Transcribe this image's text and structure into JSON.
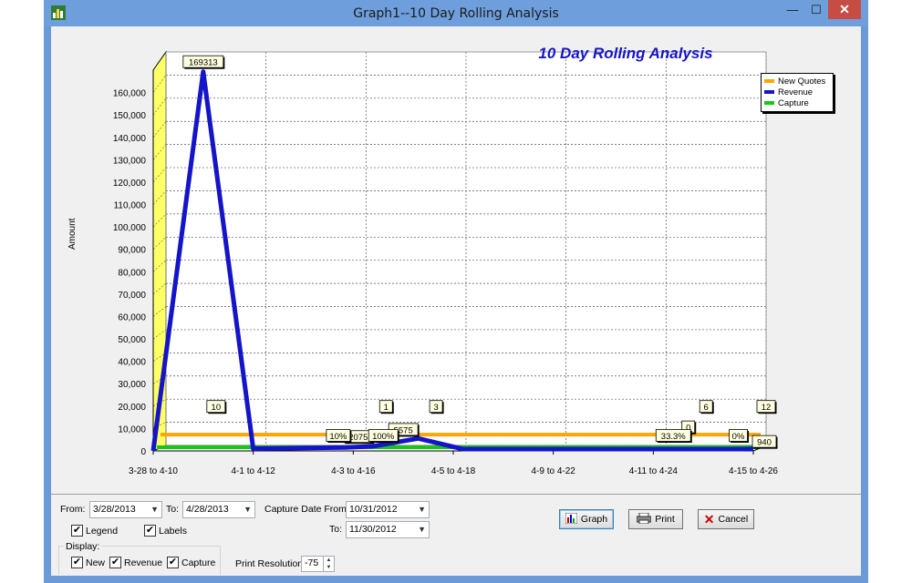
{
  "window": {
    "title": "Graph1--10 Day Rolling Analysis",
    "min_glyph": "—",
    "max_glyph": "☐",
    "close_glyph": "✕"
  },
  "colors": {
    "new_quotes": "#ffa500",
    "revenue": "#1414c8",
    "capture": "#14c814",
    "wall": "#ffff66",
    "title": "#1515c8"
  },
  "chart_data": {
    "type": "line",
    "title": "10 Day Rolling Analysis",
    "ylabel": "Amount",
    "xlabel": "",
    "ylim": [
      0,
      170000
    ],
    "yticks": [
      {
        "value": 0,
        "label": "0"
      },
      {
        "value": 10000,
        "label": "10,000"
      },
      {
        "value": 20000,
        "label": "20,000"
      },
      {
        "value": 30000,
        "label": "30,000"
      },
      {
        "value": 40000,
        "label": "40,000"
      },
      {
        "value": 50000,
        "label": "50,000"
      },
      {
        "value": 60000,
        "label": "60,000"
      },
      {
        "value": 70000,
        "label": "70,000"
      },
      {
        "value": 80000,
        "label": "80,000"
      },
      {
        "value": 90000,
        "label": "90,000"
      },
      {
        "value": 100000,
        "label": "100,000"
      },
      {
        "value": 110000,
        "label": "110,000"
      },
      {
        "value": 120000,
        "label": "120,000"
      },
      {
        "value": 130000,
        "label": "130,000"
      },
      {
        "value": 140000,
        "label": "140,000"
      },
      {
        "value": 150000,
        "label": "150,000"
      },
      {
        "value": 160000,
        "label": "160,000"
      }
    ],
    "categories": [
      "3-28 to 4-10",
      "4-1 to 4-12",
      "4-3 to 4-16",
      "4-5 to 4-18",
      "4-9 to 4-22",
      "4-11 to 4-24",
      "4-15 to 4-26"
    ],
    "legend_position": "top-right",
    "grid": true,
    "series": [
      {
        "name": "New Quotes",
        "x": [
          0,
          6
        ],
        "values": [
          4000,
          4000
        ],
        "labels": [
          {
            "x": 0.5,
            "text": "10"
          },
          {
            "x": 2.2,
            "text": "1"
          },
          {
            "x": 2.7,
            "text": "3"
          },
          {
            "x": 5.4,
            "text": "6"
          },
          {
            "x": 6.0,
            "text": "12"
          }
        ]
      },
      {
        "name": "Revenue",
        "x": [
          0,
          0.5,
          1.0,
          1.9,
          2.2,
          2.65,
          3.1,
          4.0,
          5.0,
          5.9,
          6.0
        ],
        "values": [
          0,
          169313,
          1000,
          1500,
          2075,
          5575,
          800,
          800,
          800,
          800,
          940
        ],
        "labels": [
          {
            "x": 0.5,
            "text": "169313"
          },
          {
            "x": 2.05,
            "text": "2075"
          },
          {
            "x": 2.5,
            "text": "5575"
          },
          {
            "x": 5.35,
            "text": "0"
          },
          {
            "x": 6.0,
            "text": "940"
          }
        ]
      },
      {
        "name": "Capture",
        "x": [
          0,
          6
        ],
        "values": [
          0,
          0
        ],
        "labels": [
          {
            "x": 1.85,
            "text": "10%"
          },
          {
            "x": 2.3,
            "text": "100%"
          },
          {
            "x": 5.2,
            "text": "33.3%"
          },
          {
            "x": 5.85,
            "text": "0%"
          }
        ]
      }
    ]
  },
  "controls": {
    "from_label": "From:",
    "from_value": "3/28/2013",
    "to_label": "To:",
    "to_value": "4/28/2013",
    "capture_from_label": "Capture Date From:",
    "capture_from_value": "10/31/2012",
    "capture_to_label": "To:",
    "capture_to_value": "11/30/2012",
    "legend_cb": "Legend",
    "labels_cb": "Labels",
    "display_label": "Display:",
    "new_cb": "New",
    "revenue_cb": "Revenue",
    "capture_cb": "Capture",
    "print_resolution_label": "Print Resolution:",
    "print_resolution_value": "-75",
    "graph_button": "Graph",
    "print_button": "Print",
    "cancel_button": "Cancel",
    "check_glyph": "✔",
    "dropdown_glyph": "▼"
  }
}
